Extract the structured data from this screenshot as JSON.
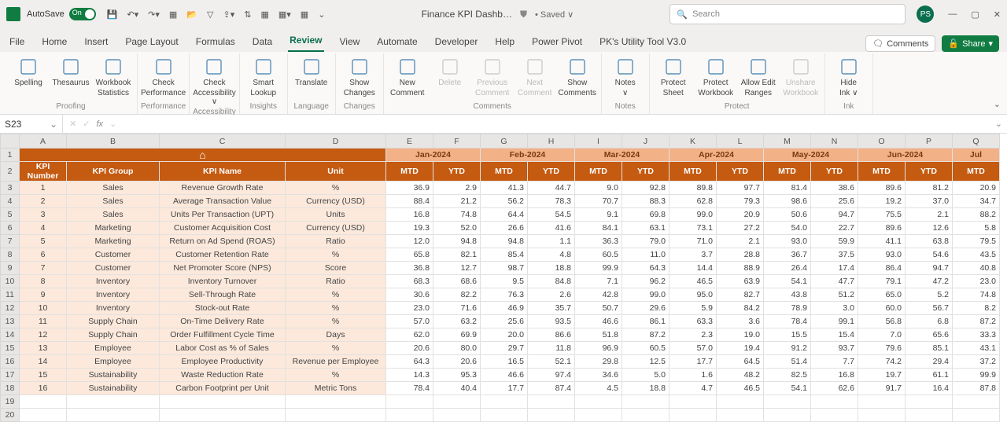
{
  "titlebar": {
    "autosave": "AutoSave",
    "docname": "Finance KPI Dashb…",
    "fileinfo": "• Saved ∨",
    "search_placeholder": "Search",
    "avatar": "PS"
  },
  "tabs": {
    "items": [
      "File",
      "Home",
      "Insert",
      "Page Layout",
      "Formulas",
      "Data",
      "Review",
      "View",
      "Automate",
      "Developer",
      "Help",
      "Power Pivot",
      "PK's Utility Tool V3.0"
    ],
    "active": "Review",
    "comments": "Comments",
    "share": "Share"
  },
  "ribbon": {
    "groups": [
      {
        "label": "Proofing",
        "btns": [
          {
            "t": "Spelling"
          },
          {
            "t": "Thesaurus"
          },
          {
            "t": "Workbook\nStatistics"
          }
        ]
      },
      {
        "label": "Performance",
        "btns": [
          {
            "t": "Check\nPerformance"
          }
        ]
      },
      {
        "label": "Accessibility",
        "btns": [
          {
            "t": "Check\nAccessibility ∨"
          }
        ]
      },
      {
        "label": "Insights",
        "btns": [
          {
            "t": "Smart\nLookup"
          }
        ]
      },
      {
        "label": "Language",
        "btns": [
          {
            "t": "Translate"
          }
        ]
      },
      {
        "label": "Changes",
        "btns": [
          {
            "t": "Show\nChanges"
          }
        ]
      },
      {
        "label": "Comments",
        "btns": [
          {
            "t": "New\nComment"
          },
          {
            "t": "Delete",
            "dim": true
          },
          {
            "t": "Previous\nComment",
            "dim": true
          },
          {
            "t": "Next\nComment",
            "dim": true
          },
          {
            "t": "Show\nComments"
          }
        ]
      },
      {
        "label": "Notes",
        "btns": [
          {
            "t": "Notes\n∨"
          }
        ]
      },
      {
        "label": "Protect",
        "btns": [
          {
            "t": "Protect\nSheet"
          },
          {
            "t": "Protect\nWorkbook"
          },
          {
            "t": "Allow Edit\nRanges"
          },
          {
            "t": "Unshare\nWorkbook",
            "dim": true
          }
        ]
      },
      {
        "label": "Ink",
        "btns": [
          {
            "t": "Hide\nInk ∨"
          }
        ]
      }
    ]
  },
  "fbar": {
    "name": "S23",
    "fx": "fx"
  },
  "sheet": {
    "cols": [
      "A",
      "B",
      "C",
      "D",
      "E",
      "F",
      "G",
      "H",
      "I",
      "J",
      "K",
      "L",
      "M",
      "N",
      "O",
      "P",
      "Q"
    ],
    "months": [
      "Jan-2024",
      "Feb-2024",
      "Mar-2024",
      "Apr-2024",
      "May-2024",
      "Jun-2024",
      "Jul"
    ],
    "subhdr": [
      "MTD",
      "YTD",
      "MTD",
      "YTD",
      "MTD",
      "YTD",
      "MTD",
      "YTD",
      "MTD",
      "YTD",
      "MTD",
      "YTD",
      "MTD"
    ],
    "labels": {
      "num": "KPI Number",
      "grp": "KPI Group",
      "name": "KPI Name",
      "unit": "Unit"
    },
    "rows": [
      {
        "n": "1",
        "g": "Sales",
        "k": "Revenue Growth Rate",
        "u": "%",
        "v": [
          "36.9",
          "2.9",
          "41.3",
          "44.7",
          "9.0",
          "92.8",
          "89.8",
          "97.7",
          "81.4",
          "38.6",
          "89.6",
          "81.2",
          "20.9"
        ]
      },
      {
        "n": "2",
        "g": "Sales",
        "k": "Average Transaction Value",
        "u": "Currency (USD)",
        "v": [
          "88.4",
          "21.2",
          "56.2",
          "78.3",
          "70.7",
          "88.3",
          "62.8",
          "79.3",
          "98.6",
          "25.6",
          "19.2",
          "37.0",
          "34.7"
        ]
      },
      {
        "n": "3",
        "g": "Sales",
        "k": "Units Per Transaction (UPT)",
        "u": "Units",
        "v": [
          "16.8",
          "74.8",
          "64.4",
          "54.5",
          "9.1",
          "69.8",
          "99.0",
          "20.9",
          "50.6",
          "94.7",
          "75.5",
          "2.1",
          "88.2"
        ]
      },
      {
        "n": "4",
        "g": "Marketing",
        "k": "Customer Acquisition Cost",
        "u": "Currency (USD)",
        "v": [
          "19.3",
          "52.0",
          "26.6",
          "41.6",
          "84.1",
          "63.1",
          "73.1",
          "27.2",
          "54.0",
          "22.7",
          "89.6",
          "12.6",
          "5.8"
        ]
      },
      {
        "n": "5",
        "g": "Marketing",
        "k": "Return on Ad Spend (ROAS)",
        "u": "Ratio",
        "v": [
          "12.0",
          "94.8",
          "94.8",
          "1.1",
          "36.3",
          "79.0",
          "71.0",
          "2.1",
          "93.0",
          "59.9",
          "41.1",
          "63.8",
          "79.5"
        ]
      },
      {
        "n": "6",
        "g": "Customer",
        "k": "Customer Retention Rate",
        "u": "%",
        "v": [
          "65.8",
          "82.1",
          "85.4",
          "4.8",
          "60.5",
          "11.0",
          "3.7",
          "28.8",
          "36.7",
          "37.5",
          "93.0",
          "54.6",
          "43.5"
        ]
      },
      {
        "n": "7",
        "g": "Customer",
        "k": "Net Promoter Score (NPS)",
        "u": "Score",
        "v": [
          "36.8",
          "12.7",
          "98.7",
          "18.8",
          "99.9",
          "64.3",
          "14.4",
          "88.9",
          "26.4",
          "17.4",
          "86.4",
          "94.7",
          "40.8"
        ]
      },
      {
        "n": "8",
        "g": "Inventory",
        "k": "Inventory Turnover",
        "u": "Ratio",
        "v": [
          "68.3",
          "68.6",
          "9.5",
          "84.8",
          "7.1",
          "96.2",
          "46.5",
          "63.9",
          "54.1",
          "47.7",
          "79.1",
          "47.2",
          "23.0"
        ]
      },
      {
        "n": "9",
        "g": "Inventory",
        "k": "Sell-Through Rate",
        "u": "%",
        "v": [
          "30.6",
          "82.2",
          "76.3",
          "2.6",
          "42.8",
          "99.0",
          "95.0",
          "82.7",
          "43.8",
          "51.2",
          "65.0",
          "5.2",
          "74.8"
        ]
      },
      {
        "n": "10",
        "g": "Inventory",
        "k": "Stock-out Rate",
        "u": "%",
        "v": [
          "23.0",
          "71.6",
          "46.9",
          "35.7",
          "50.7",
          "29.6",
          "5.9",
          "84.2",
          "78.9",
          "3.0",
          "60.0",
          "56.7",
          "8.2"
        ]
      },
      {
        "n": "11",
        "g": "Supply Chain",
        "k": "On-Time Delivery Rate",
        "u": "%",
        "v": [
          "57.0",
          "63.2",
          "25.6",
          "93.5",
          "46.6",
          "86.1",
          "63.3",
          "3.6",
          "78.4",
          "99.1",
          "56.8",
          "6.8",
          "87.2"
        ]
      },
      {
        "n": "12",
        "g": "Supply Chain",
        "k": "Order Fulfillment Cycle Time",
        "u": "Days",
        "v": [
          "62.0",
          "69.9",
          "20.0",
          "86.6",
          "51.8",
          "87.2",
          "2.3",
          "19.0",
          "15.5",
          "15.4",
          "7.0",
          "65.6",
          "33.3"
        ]
      },
      {
        "n": "13",
        "g": "Employee",
        "k": "Labor Cost as % of Sales",
        "u": "%",
        "v": [
          "20.6",
          "80.0",
          "29.7",
          "11.8",
          "96.9",
          "60.5",
          "57.0",
          "19.4",
          "91.2",
          "93.7",
          "79.6",
          "85.1",
          "43.1"
        ]
      },
      {
        "n": "14",
        "g": "Employee",
        "k": "Employee Productivity",
        "u": "Revenue per Employee",
        "v": [
          "64.3",
          "20.6",
          "16.5",
          "52.1",
          "29.8",
          "12.5",
          "17.7",
          "64.5",
          "51.4",
          "7.7",
          "74.2",
          "29.4",
          "37.2"
        ]
      },
      {
        "n": "15",
        "g": "Sustainability",
        "k": "Waste Reduction Rate",
        "u": "%",
        "v": [
          "14.3",
          "95.3",
          "46.6",
          "97.4",
          "34.6",
          "5.0",
          "1.6",
          "48.2",
          "82.5",
          "16.8",
          "19.7",
          "61.1",
          "99.9"
        ]
      },
      {
        "n": "16",
        "g": "Sustainability",
        "k": "Carbon Footprint per Unit",
        "u": "Metric Tons",
        "v": [
          "78.4",
          "40.4",
          "17.7",
          "87.4",
          "4.5",
          "18.8",
          "4.7",
          "46.5",
          "54.1",
          "62.6",
          "91.7",
          "16.4",
          "87.8"
        ]
      }
    ]
  }
}
